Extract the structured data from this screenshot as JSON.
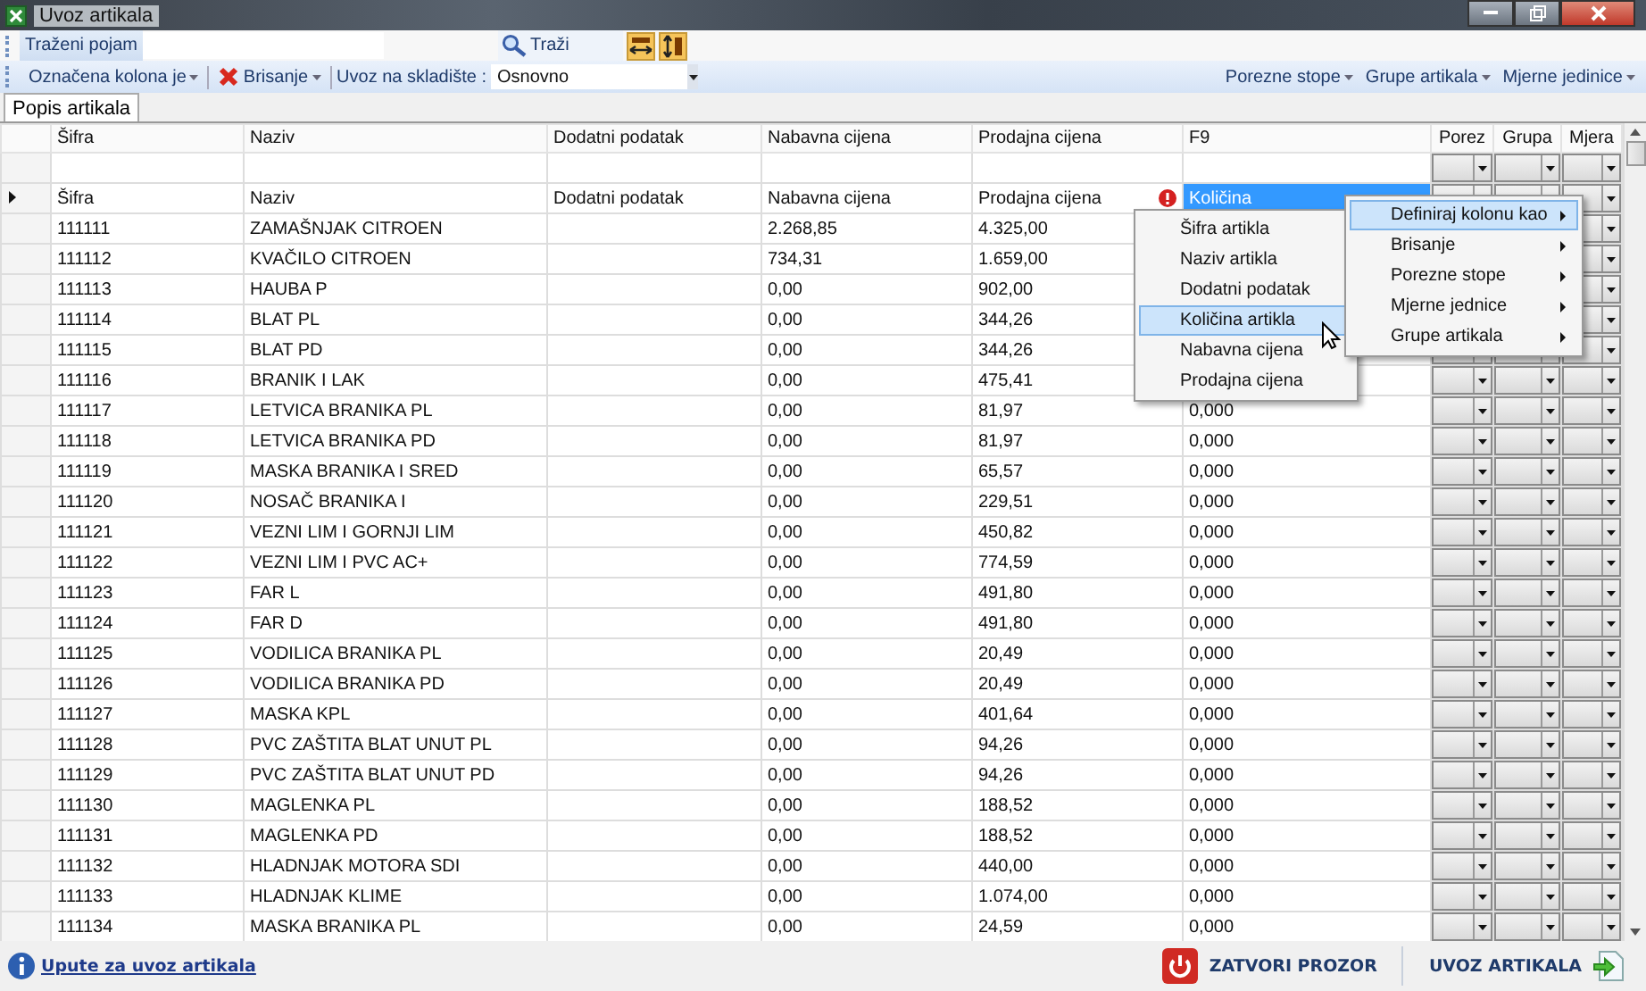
{
  "window": {
    "title": "Uvoz artikala"
  },
  "search_bar": {
    "label": "Traženi pojam",
    "button": "Traži"
  },
  "toolbar": {
    "left": [
      {
        "label": "Označena kolona je",
        "kind": "menu"
      },
      {
        "label": "Brisanje",
        "kind": "delete"
      }
    ],
    "warehouse_label": "Uvoz na skladište :",
    "warehouse_value": "Osnovno",
    "right": [
      "Porezne stope",
      "Grupe artikala",
      "Mjerne jedinice"
    ]
  },
  "tabs": [
    {
      "label": "Popis artikala",
      "selected": true
    }
  ],
  "table": {
    "columns": [
      "Šifra",
      "Naziv",
      "Dodatni podatak",
      "Nabavna cijena",
      "Prodajna cijena",
      "F9",
      "Porez",
      "Grupa",
      "Mjera"
    ],
    "header_row": {
      "current": true,
      "cells": [
        "Šifra",
        "Naziv",
        "Dodatni podatak",
        "Nabavna cijena",
        "Prodajna cijena"
      ],
      "f9": "Količina",
      "error": true
    },
    "rows": [
      {
        "sifra": "111111",
        "naziv": "ZAMAŠNJAK CITROEN",
        "nabavna": "2.268,85",
        "prodajna": "4.325,00"
      },
      {
        "sifra": "111112",
        "naziv": "KVAČILO CITROEN",
        "nabavna": "734,31",
        "prodajna": "1.659,00"
      },
      {
        "sifra": "111113",
        "naziv": "HAUBA P",
        "nabavna": "0,00",
        "prodajna": "902,00"
      },
      {
        "sifra": "111114",
        "naziv": "BLAT PL",
        "nabavna": "0,00",
        "prodajna": "344,26"
      },
      {
        "sifra": "111115",
        "naziv": "BLAT PD",
        "nabavna": "0,00",
        "prodajna": "344,26"
      },
      {
        "sifra": "111116",
        "naziv": "BRANIK I LAK",
        "nabavna": "0,00",
        "prodajna": "475,41"
      },
      {
        "sifra": "111117",
        "naziv": "LETVICA BRANIKA PL",
        "nabavna": "0,00",
        "prodajna": "81,97",
        "f9": "0,000"
      },
      {
        "sifra": "111118",
        "naziv": "LETVICA BRANIKA PD",
        "nabavna": "0,00",
        "prodajna": "81,97",
        "f9": "0,000"
      },
      {
        "sifra": "111119",
        "naziv": "MASKA BRANIKA I SRED",
        "nabavna": "0,00",
        "prodajna": "65,57",
        "f9": "0,000"
      },
      {
        "sifra": "111120",
        "naziv": "NOSAČ BRANIKA I",
        "nabavna": "0,00",
        "prodajna": "229,51",
        "f9": "0,000"
      },
      {
        "sifra": "111121",
        "naziv": "VEZNI LIM I GORNJI LIM",
        "nabavna": "0,00",
        "prodajna": "450,82",
        "f9": "0,000"
      },
      {
        "sifra": "111122",
        "naziv": "VEZNI LIM I PVC AC+",
        "nabavna": "0,00",
        "prodajna": "774,59",
        "f9": "0,000"
      },
      {
        "sifra": "111123",
        "naziv": "FAR L",
        "nabavna": "0,00",
        "prodajna": "491,80",
        "f9": "0,000"
      },
      {
        "sifra": "111124",
        "naziv": "FAR D",
        "nabavna": "0,00",
        "prodajna": "491,80",
        "f9": "0,000"
      },
      {
        "sifra": "111125",
        "naziv": "VODILICA BRANIKA PL",
        "nabavna": "0,00",
        "prodajna": "20,49",
        "f9": "0,000"
      },
      {
        "sifra": "111126",
        "naziv": "VODILICA BRANIKA PD",
        "nabavna": "0,00",
        "prodajna": "20,49",
        "f9": "0,000"
      },
      {
        "sifra": "111127",
        "naziv": "MASKA KPL",
        "nabavna": "0,00",
        "prodajna": "401,64",
        "f9": "0,000"
      },
      {
        "sifra": "111128",
        "naziv": "PVC ZAŠTITA BLAT UNUT PL",
        "nabavna": "0,00",
        "prodajna": "94,26",
        "f9": "0,000"
      },
      {
        "sifra": "111129",
        "naziv": "PVC ZAŠTITA BLAT UNUT PD",
        "nabavna": "0,00",
        "prodajna": "94,26",
        "f9": "0,000"
      },
      {
        "sifra": "111130",
        "naziv": "MAGLENKA PL",
        "nabavna": "0,00",
        "prodajna": "188,52",
        "f9": "0,000"
      },
      {
        "sifra": "111131",
        "naziv": "MAGLENKA PD",
        "nabavna": "0,00",
        "prodajna": "188,52",
        "f9": "0,000"
      },
      {
        "sifra": "111132",
        "naziv": "HLADNJAK MOTORA SDI",
        "nabavna": "0,00",
        "prodajna": "440,00",
        "f9": "0,000"
      },
      {
        "sifra": "111133",
        "naziv": "HLADNJAK KLIME",
        "nabavna": "0,00",
        "prodajna": "1.074,00",
        "f9": "0,000"
      },
      {
        "sifra": "111134",
        "naziv": "MASKA BRANIKA PL",
        "nabavna": "0,00",
        "prodajna": "24,59",
        "f9": "0,000"
      }
    ]
  },
  "context_menu": [
    {
      "label": "Šifra artikla",
      "selected": false
    },
    {
      "label": "Naziv artikla",
      "selected": false
    },
    {
      "label": "Dodatni podatak",
      "selected": false
    },
    {
      "label": "Količina artikla",
      "selected": true
    },
    {
      "label": "Nabavna cijena",
      "selected": false
    },
    {
      "label": "Prodajna cijena",
      "selected": false
    }
  ],
  "submenu": [
    {
      "label": "Definiraj kolonu kao",
      "selected": true
    },
    {
      "label": "Brisanje",
      "selected": false
    },
    {
      "label": "Porezne stope",
      "selected": false
    },
    {
      "label": "Mjerne jednice",
      "selected": false
    },
    {
      "label": "Grupe artikala",
      "selected": false
    }
  ],
  "footer": {
    "help_link": "Upute za uvoz artikala",
    "close_button": "ZATVORI PROZOR",
    "import_button": "UVOZ ARTIKALA"
  }
}
